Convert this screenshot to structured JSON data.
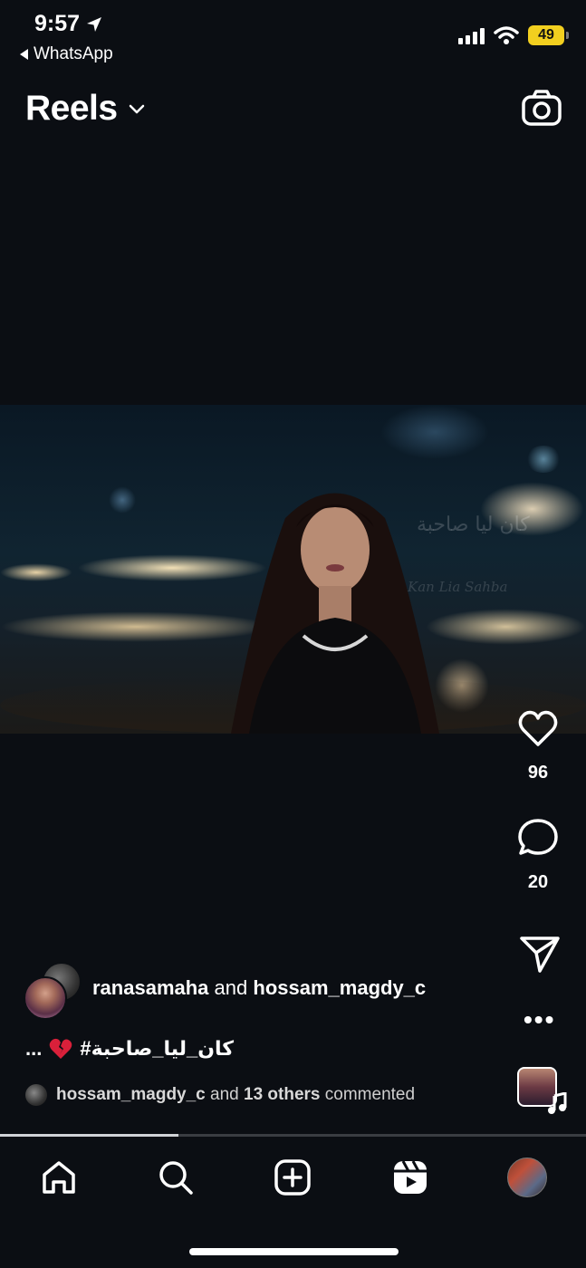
{
  "status_bar": {
    "time": "9:57",
    "back_app": "WhatsApp",
    "battery": "49",
    "battery_color": "#f2cf1f"
  },
  "header": {
    "title": "Reels",
    "dropdown_icon": "chevron-down-icon",
    "camera_icon": "camera-icon"
  },
  "video": {
    "watermark_arabic": "كان ليا صاحبة",
    "watermark_latin": "Kan Lia Sahba"
  },
  "actions": {
    "like_count": "96",
    "comment_count": "20",
    "more": "•••"
  },
  "post": {
    "author_1": "ranasamaha",
    "joiner": "and",
    "author_2": "hossam_magdy_c",
    "caption_prefix": "...",
    "caption_emoji_icon": "broken-heart-icon",
    "caption_text": "#كان_ليا_صاحبة",
    "comments_user": "hossam_magdy_c",
    "comments_and": "and",
    "comments_others": "13 others",
    "comments_suffix": "commented"
  },
  "progress": {
    "fraction": 0.305
  },
  "tabbar": {
    "items": [
      "home-icon",
      "search-icon",
      "create-icon",
      "reels-icon",
      "profile-avatar"
    ]
  }
}
